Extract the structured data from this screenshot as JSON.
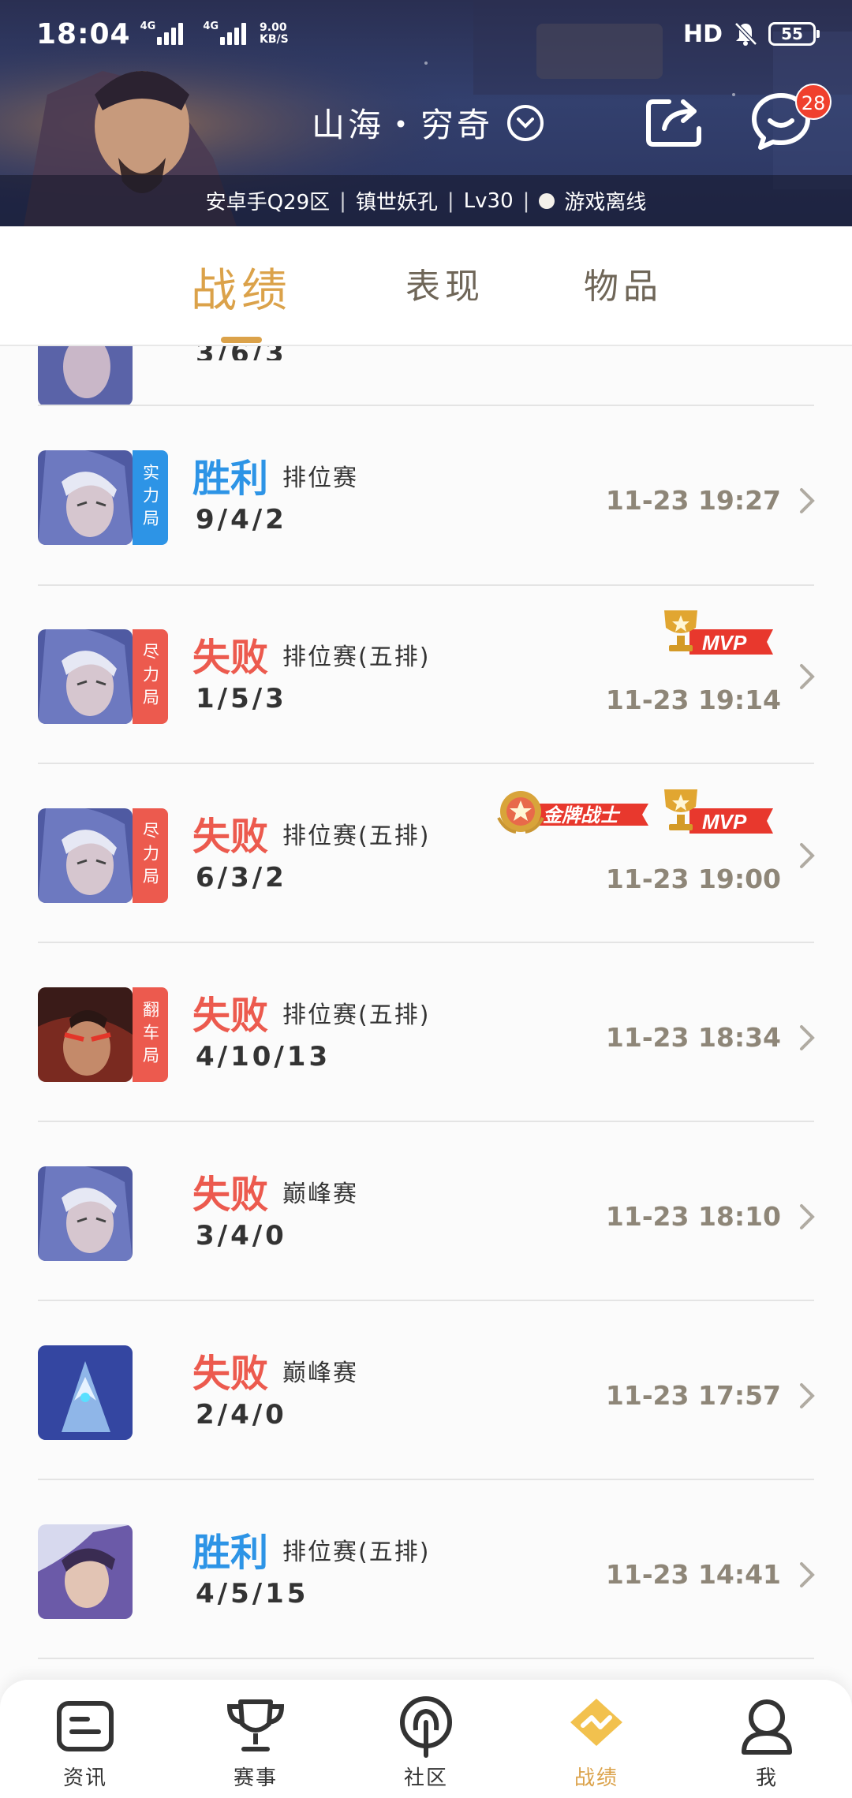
{
  "status_bar": {
    "time": "18:04",
    "net1": "4G",
    "net2": "4G",
    "speed_value": "9.00",
    "speed_unit": "KB/S",
    "hd": "HD",
    "battery": "55"
  },
  "header": {
    "account_name": "山海・穷奇",
    "chat_badge": "28",
    "server": "安卓手Q29区",
    "rank": "镇世妖孔",
    "level": "Lv30",
    "status": "游戏离线"
  },
  "tabs": [
    {
      "label": "战绩",
      "active": true
    },
    {
      "label": "表现",
      "active": false
    },
    {
      "label": "物品",
      "active": false
    }
  ],
  "partial_record": {
    "kda": "3/6/3"
  },
  "records": [
    {
      "result": "胜利",
      "outcome": "win",
      "mode": "排位赛",
      "kda": "9/4/2",
      "time": "11-23 19:27",
      "tag": "实力局",
      "tag_color": "#2d94e6",
      "badges": []
    },
    {
      "result": "失败",
      "outcome": "lose",
      "mode": "排位赛(五排)",
      "kda": "1/5/3",
      "time": "11-23 19:14",
      "tag": "尽力局",
      "tag_color": "#ec5a4e",
      "badges": [
        "MVP"
      ]
    },
    {
      "result": "失败",
      "outcome": "lose",
      "mode": "排位赛(五排)",
      "kda": "6/3/2",
      "time": "11-23 19:00",
      "tag": "尽力局",
      "tag_color": "#ec5a4e",
      "badges": [
        "金牌战士",
        "MVP"
      ]
    },
    {
      "result": "失败",
      "outcome": "lose",
      "mode": "排位赛(五排)",
      "kda": "4/10/13",
      "time": "11-23 18:34",
      "tag": "翻车局",
      "tag_color": "#ec5a4e",
      "badges": []
    },
    {
      "result": "失败",
      "outcome": "lose",
      "mode": "巅峰赛",
      "kda": "3/4/0",
      "time": "11-23 18:10",
      "tag": "",
      "tag_color": "",
      "badges": []
    },
    {
      "result": "失败",
      "outcome": "lose",
      "mode": "巅峰赛",
      "kda": "2/4/0",
      "time": "11-23 17:57",
      "tag": "",
      "tag_color": "",
      "badges": []
    },
    {
      "result": "胜利",
      "outcome": "win",
      "mode": "排位赛(五排)",
      "kda": "4/5/15",
      "time": "11-23 14:41",
      "tag": "",
      "tag_color": "",
      "badges": []
    }
  ],
  "bottom_nav": [
    {
      "label": "资讯",
      "icon": "news-icon",
      "active": false
    },
    {
      "label": "赛事",
      "icon": "trophy-icon",
      "active": false
    },
    {
      "label": "社区",
      "icon": "community-icon",
      "active": false
    },
    {
      "label": "战绩",
      "icon": "record-icon",
      "active": true
    },
    {
      "label": "我",
      "icon": "profile-icon",
      "active": false
    }
  ],
  "colors": {
    "accent": "#dba24a",
    "win": "#2d94e6",
    "lose": "#ec5a4e",
    "badge_red": "#f0402d"
  }
}
